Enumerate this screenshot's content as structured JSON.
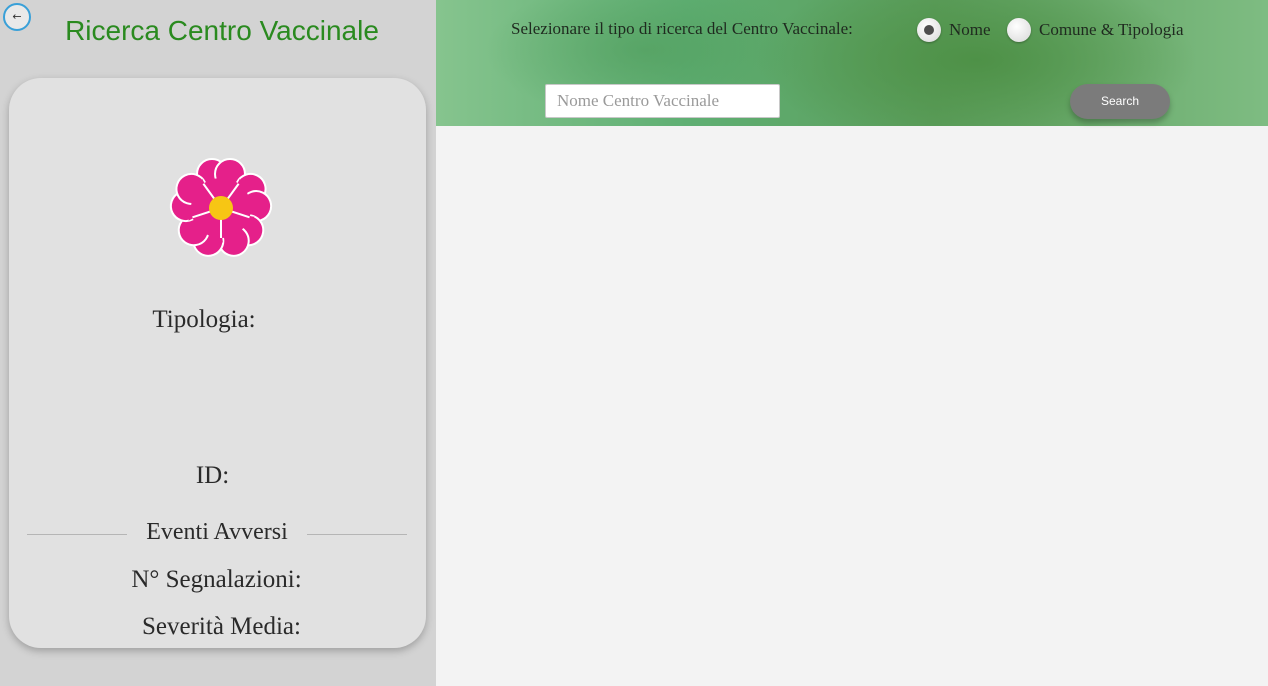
{
  "sidebar": {
    "back_label": "←",
    "title": "Ricerca Centro Vaccinale",
    "card": {
      "icon": "flower-icon",
      "tipologia_label": "Tipologia:",
      "id_label": "ID:",
      "section_label": "Eventi Avversi",
      "segnalazioni_label": "N° Segnalazioni:",
      "severita_label": "Severità Media:"
    }
  },
  "topbar": {
    "prompt": "Selezionare il tipo di ricerca del Centro Vaccinale:",
    "options": [
      {
        "label": "Nome",
        "selected": true
      },
      {
        "label": "Comune & Tipologia",
        "selected": false
      }
    ],
    "search": {
      "value": "",
      "placeholder": "Nome Centro Vaccinale"
    },
    "search_button": "Search"
  },
  "colors": {
    "title_green": "#2a8a1f",
    "flower_pink": "#e5208a",
    "flower_center": "#f7c614",
    "button_gray": "#7b7b7b",
    "back_border": "#39a0d8"
  }
}
